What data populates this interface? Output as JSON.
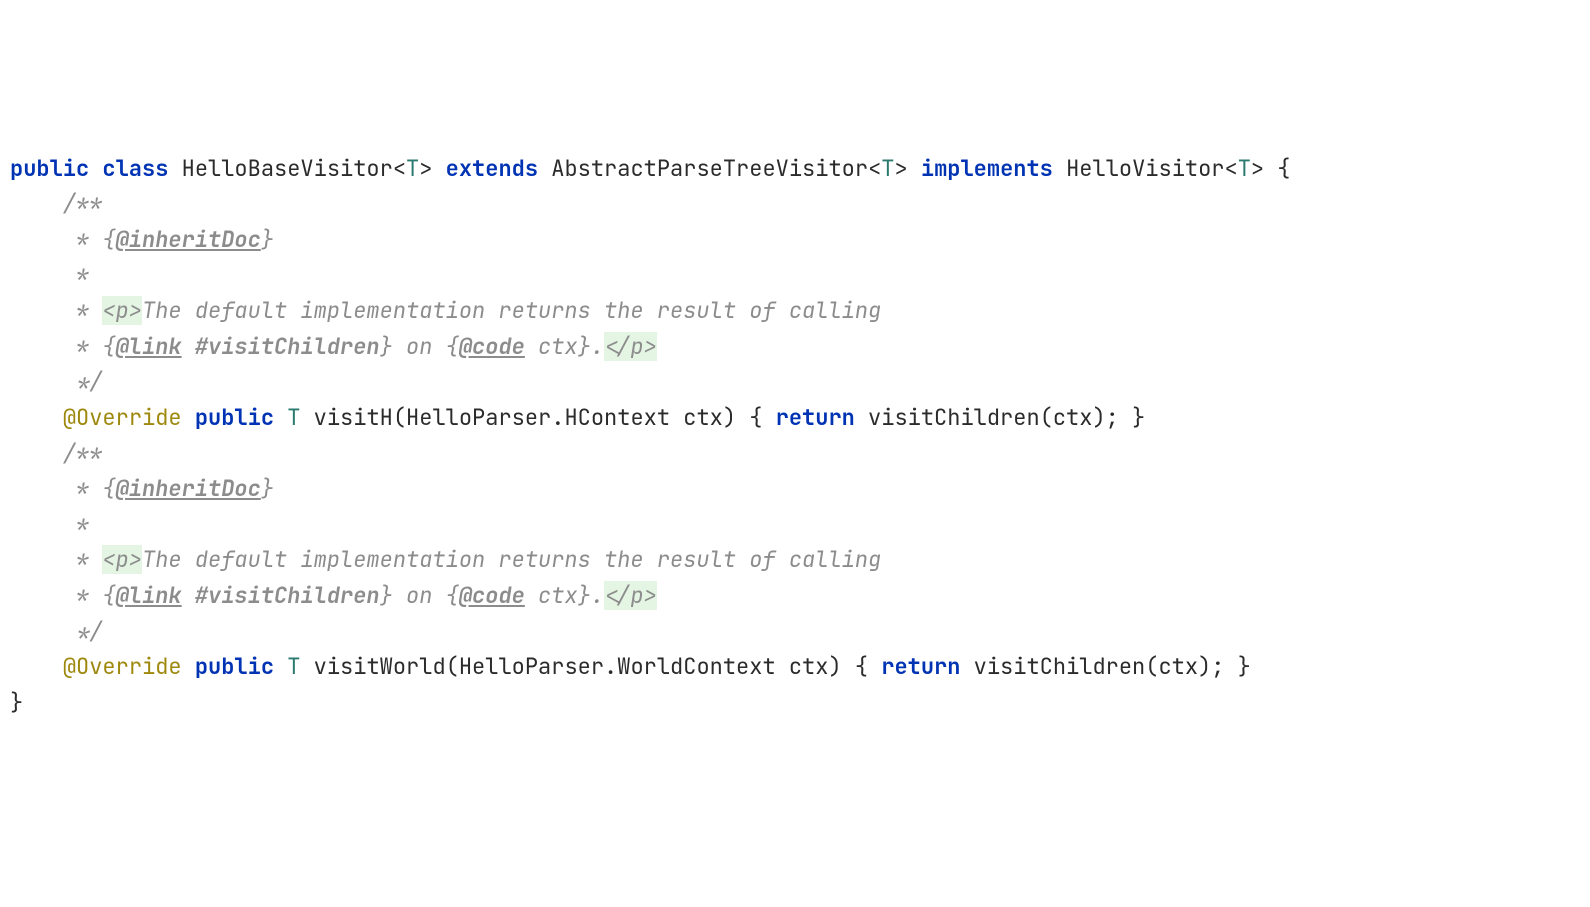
{
  "code": {
    "line1": {
      "kw_public": "public",
      "kw_class": "class",
      "classname": "HelloBaseVisitor",
      "lt1": "<",
      "T1": "T",
      "gt1": ">",
      "kw_extends": "extends",
      "superclass": "AbstractParseTreeVisitor",
      "lt2": "<",
      "T2": "T",
      "gt2": ">",
      "kw_implements": "implements",
      "iface": "HelloVisitor",
      "lt3": "<",
      "T3": "T",
      "gt3": ">",
      "brace": " {"
    },
    "doc1": {
      "l1": "    /**",
      "l2a": "     * {",
      "l2b": "@inheritDoc",
      "l2c": "}",
      "l3": "     *",
      "l4a": "     * ",
      "l4b": "<p>",
      "l4c": "The default implementation returns the result of calling",
      "l5a": "     * {",
      "l5b": "@link",
      "l5c": " ",
      "l5d": "#visitChildren",
      "l5e": "} on {",
      "l5f": "@code",
      "l5g": " ctx}.",
      "l5h": "</p>",
      "l6": "     */"
    },
    "method1": {
      "indent": "    ",
      "ann": "@Override",
      "sp1": " ",
      "kw_public": "public",
      "sp2": " ",
      "T": "T",
      "sp3": " ",
      "name": "visitH(HelloParser.HContext ctx) { ",
      "kw_return": "return",
      "rest": " visitChildren(ctx); }"
    },
    "doc2": {
      "l1": "    /**",
      "l2a": "     * {",
      "l2b": "@inheritDoc",
      "l2c": "}",
      "l3": "     *",
      "l4a": "     * ",
      "l4b": "<p>",
      "l4c": "The default implementation returns the result of calling",
      "l5a": "     * {",
      "l5b": "@link",
      "l5c": " ",
      "l5d": "#visitChildren",
      "l5e": "} on {",
      "l5f": "@code",
      "l5g": " ctx}.",
      "l5h": "</p>",
      "l6": "     */"
    },
    "method2": {
      "indent": "    ",
      "ann": "@Override",
      "sp1": " ",
      "kw_public": "public",
      "sp2": " ",
      "T": "T",
      "sp3": " ",
      "name": "visitWorld(HelloParser.WorldContext ctx) { ",
      "kw_return": "return",
      "rest": " visitChildren(ctx); }"
    },
    "close": "}"
  }
}
